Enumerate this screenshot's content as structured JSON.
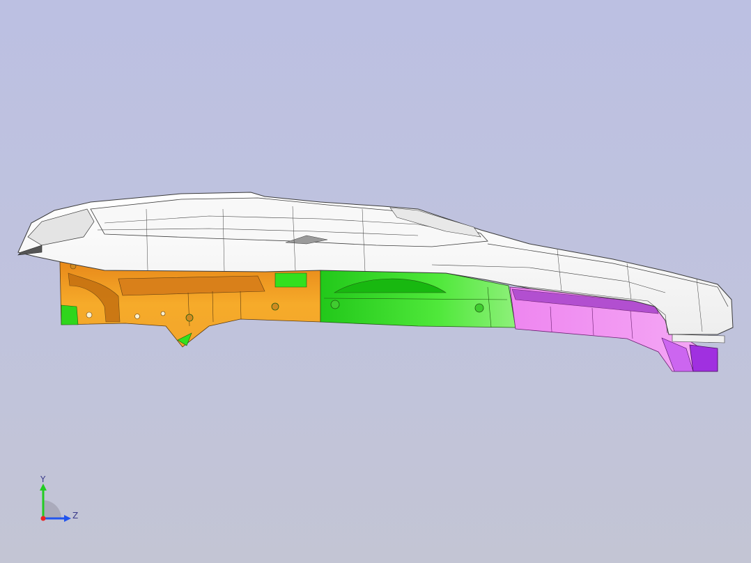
{
  "viewport": {
    "background_top": "#bcc0e2",
    "background_bottom": "#c3c5d4"
  },
  "model": {
    "part_colors": {
      "upper_shell": "#ffffff",
      "rear_section": "#f3a020",
      "middle_section": "#33e01e",
      "front_section": "#ef86f2",
      "edge_lines": "#3a3a3a"
    }
  },
  "triad": {
    "y_label": "Y",
    "z_label": "Z",
    "y_color": "#22cc22",
    "z_color": "#2255ee",
    "x_color": "#ee2222"
  }
}
